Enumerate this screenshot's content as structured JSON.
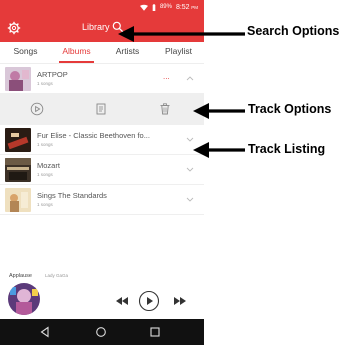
{
  "status": {
    "battery": "89%",
    "time": "8:52",
    "meridiem": "PM"
  },
  "app_bar": {
    "title": "Library"
  },
  "tabs": [
    {
      "label": "Songs",
      "active": false
    },
    {
      "label": "Albums",
      "active": true
    },
    {
      "label": "Artists",
      "active": false
    },
    {
      "label": "Playlist",
      "active": false
    }
  ],
  "albums": [
    {
      "name": "ARTPOP",
      "songs": "1 songs",
      "expanded": true
    },
    {
      "name": "Fur Elise - Classic Beethoven fo...",
      "songs": "1 songs",
      "expanded": false
    },
    {
      "name": "Mozart",
      "songs": "1 songs",
      "expanded": false
    },
    {
      "name": "Sings The Standards",
      "songs": "1 songs",
      "expanded": false
    }
  ],
  "more_glyph": "...",
  "player": {
    "title": "Applause",
    "artist": "Lady GaGa"
  },
  "annotations": {
    "search": "Search Options",
    "track_options": "Track Options",
    "track_listing": "Track Listing"
  },
  "colors": {
    "accent": "#e53a3a",
    "options_bg": "#efefef",
    "navbar": "#111111",
    "arrow": "#000000"
  },
  "icons": [
    "gear-icon",
    "search-icon",
    "play-circle-icon",
    "note-icon",
    "trash-icon",
    "chevron-up-icon",
    "chevron-down-icon",
    "rewind-icon",
    "play-icon",
    "fast-forward-icon",
    "back-icon",
    "home-icon",
    "recents-icon"
  ]
}
